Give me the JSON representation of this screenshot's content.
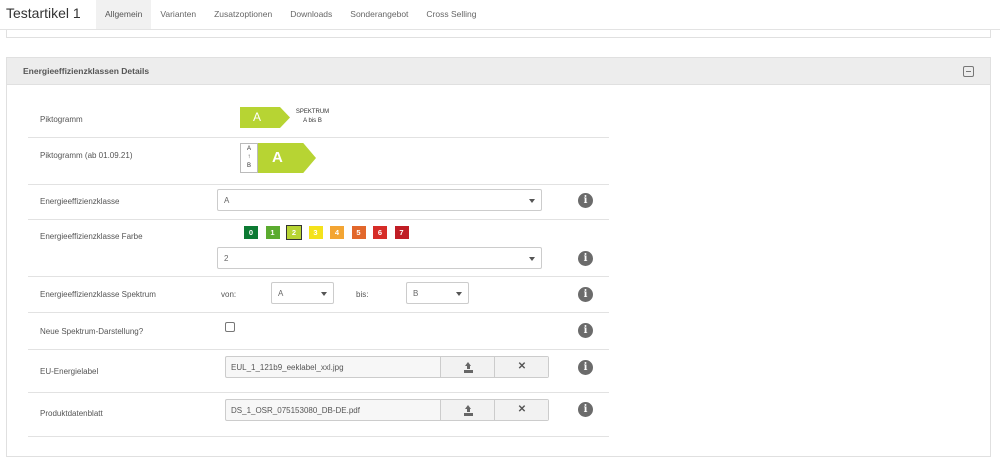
{
  "header": {
    "title": "Testartikel 1",
    "tabs": [
      {
        "label": "Allgemein",
        "active": true
      },
      {
        "label": "Varianten"
      },
      {
        "label": "Zusatzoptionen"
      },
      {
        "label": "Downloads"
      },
      {
        "label": "Sonderangebot"
      },
      {
        "label": "Cross Selling"
      }
    ]
  },
  "panel": {
    "title": "Energieeffizienzklassen Details",
    "collapse_icon": "minus-square-icon"
  },
  "fields": {
    "piktogramm": {
      "label": "Piktogramm",
      "letter": "A",
      "spectrum_title": "SPEKTRUM",
      "spectrum_range": "A bis B"
    },
    "piktogramm_new": {
      "label": "Piktogramm (ab 01.09.21)",
      "scale_top": "A",
      "scale_arrow": "↑",
      "scale_bottom": "B",
      "letter": "A"
    },
    "klasse": {
      "label": "Energieeffizienzklasse",
      "value": "A"
    },
    "farbe": {
      "label": "Energieeffizienzklasse Farbe",
      "value": "2",
      "chips": [
        {
          "label": "0",
          "color": "#0c7a33"
        },
        {
          "label": "1",
          "color": "#5bab2f"
        },
        {
          "label": "2",
          "color": "#b7d433",
          "selected": true
        },
        {
          "label": "3",
          "color": "#f4e21b"
        },
        {
          "label": "4",
          "color": "#f3a533"
        },
        {
          "label": "5",
          "color": "#e2672b"
        },
        {
          "label": "6",
          "color": "#d62c27"
        },
        {
          "label": "7",
          "color": "#c01d25"
        }
      ]
    },
    "spektrum": {
      "label": "Energieeffizienzklasse Spektrum",
      "von_label": "von:",
      "von_value": "A",
      "bis_label": "bis:",
      "bis_value": "B"
    },
    "neue_darstellung": {
      "label": "Neue Spektrum-Darstellung?",
      "checked": false
    },
    "eu_label": {
      "label": "EU-Energielabel",
      "filename": "EUL_1_121b9_eeklabel_xxl.jpg"
    },
    "datenblatt": {
      "label": "Produktdatenblatt",
      "filename": "DS_1_OSR_075153080_DB-DE.pdf"
    }
  },
  "icons": {
    "info": "info-circle-icon",
    "upload": "upload-icon",
    "remove": "close-icon",
    "info_glyph": "i",
    "remove_glyph": "✕"
  }
}
